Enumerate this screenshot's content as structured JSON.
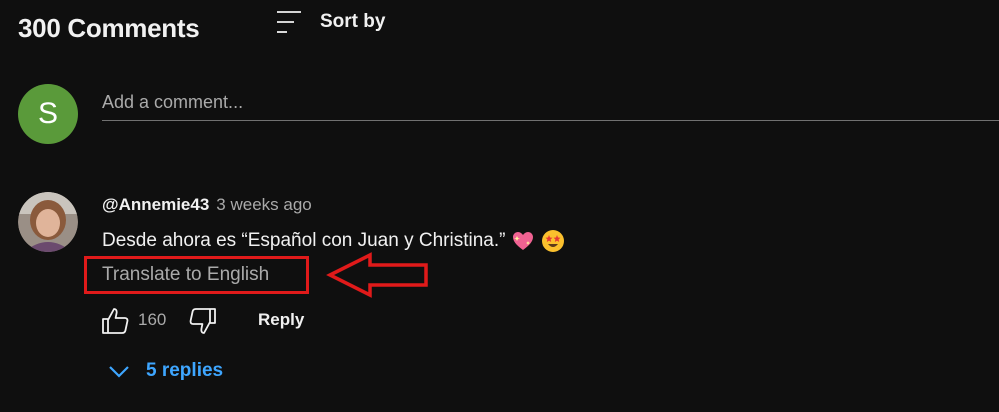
{
  "header": {
    "comment_count_label": "300 Comments",
    "sort_label": "Sort by"
  },
  "composer": {
    "avatar_initial": "S",
    "placeholder": "Add a comment..."
  },
  "comment": {
    "author": "@Annemie43",
    "time": "3 weeks ago",
    "text": "Desde ahora es “Español con Juan y Christina.”",
    "emojis": [
      "sparkling-heart",
      "star-struck"
    ],
    "translate_label": "Translate to English",
    "like_count": "160",
    "reply_label": "Reply",
    "replies_label": "5 replies"
  },
  "colors": {
    "background": "#0f0f0f",
    "link_blue": "#3ea6ff",
    "annotation_red": "#e01a1a",
    "composer_avatar": "#5a9a3a"
  }
}
